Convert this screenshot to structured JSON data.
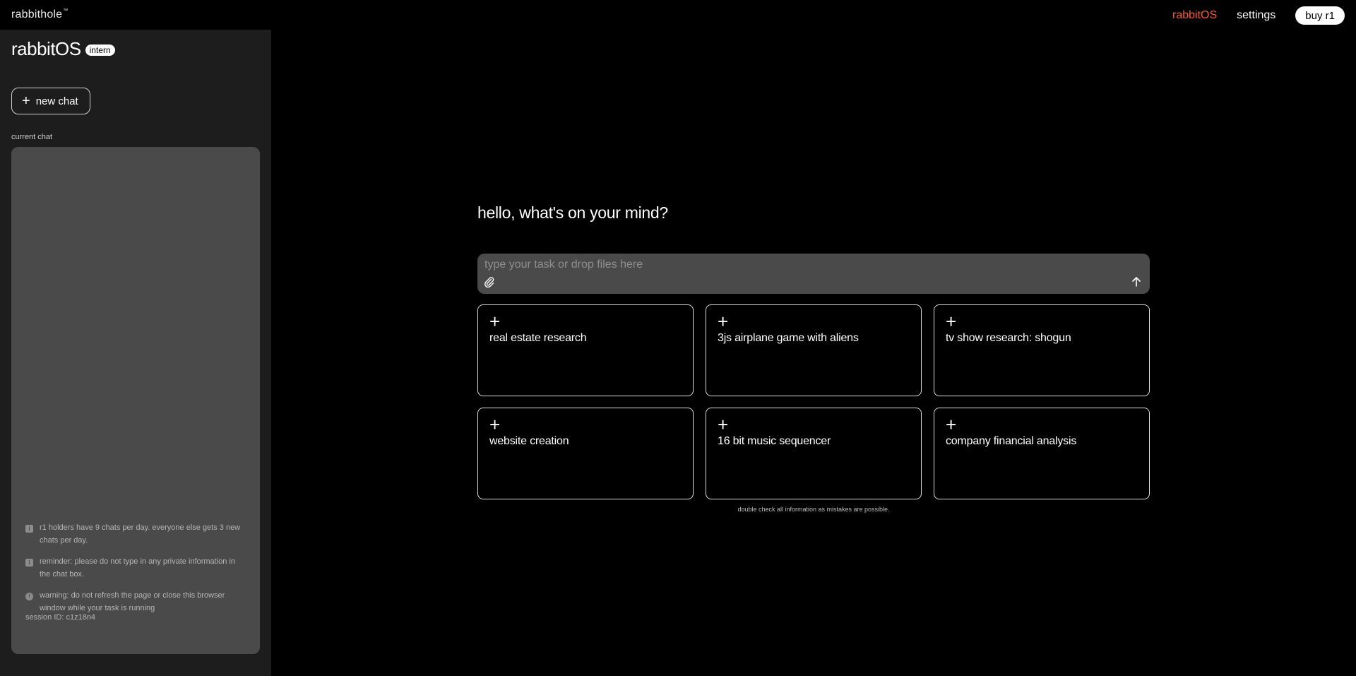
{
  "header": {
    "logo": "rabbithole",
    "logo_mark": "™",
    "nav": [
      {
        "label": "rabbitOS"
      },
      {
        "label": "settings"
      }
    ],
    "buy_label": "buy r1",
    "accent_color": "#ff5a2c"
  },
  "sidebar": {
    "title": "rabbitOS",
    "badge": "intern",
    "new_chat_label": "new chat",
    "current_chat_label": "current chat",
    "notices": [
      {
        "icon": "info-icon",
        "text": "r1 holders have 9 chats per day. everyone else gets 3 new chats per day."
      },
      {
        "icon": "info-icon",
        "text": "reminder: please do not type in any private information in the chat box."
      },
      {
        "icon": "warning-icon",
        "text": "warning: do not refresh the page or close this browser window while your task is running"
      }
    ],
    "session": "session ID: c1z18n4"
  },
  "main": {
    "greeting": "hello, what's on your mind?",
    "input_placeholder": "type your task or drop files here",
    "suggestions": [
      {
        "label": "real estate research"
      },
      {
        "label": "3js airplane game with aliens"
      },
      {
        "label": "tv show research: shogun"
      },
      {
        "label": "website creation"
      },
      {
        "label": "16 bit music sequencer"
      },
      {
        "label": "company financial analysis"
      }
    ],
    "disclaimer": "double check all information as mistakes are possible."
  }
}
